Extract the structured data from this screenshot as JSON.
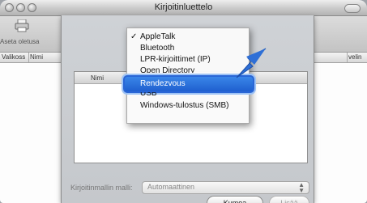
{
  "window": {
    "title": "Kirjoitinluettelo"
  },
  "toolbar": {
    "set_default_label": "Aseta oletusa"
  },
  "columns": [
    "Valikoss",
    "Nimi",
    "velin"
  ],
  "sheet": {
    "list_header": "Nimi",
    "model_label": "Kirjoitinmallin malli:",
    "model_value": "Automaattinen",
    "cancel_label": "Kumoa",
    "add_label": "Lisää"
  },
  "menu": {
    "items": [
      {
        "label": "AppleTalk",
        "checked": true
      },
      {
        "label": "Bluetooth"
      },
      {
        "label": "LPR-kirjoittimet (IP)"
      },
      {
        "label": "Open Directory"
      },
      {
        "label": "Rendezvous",
        "selected": true
      },
      {
        "label": "USB"
      },
      {
        "label": "Windows-tulostus (SMB)"
      }
    ],
    "checkmark": "✓"
  },
  "colors": {
    "highlight": "#2a66d6",
    "arrow": "#2e6fd6"
  }
}
